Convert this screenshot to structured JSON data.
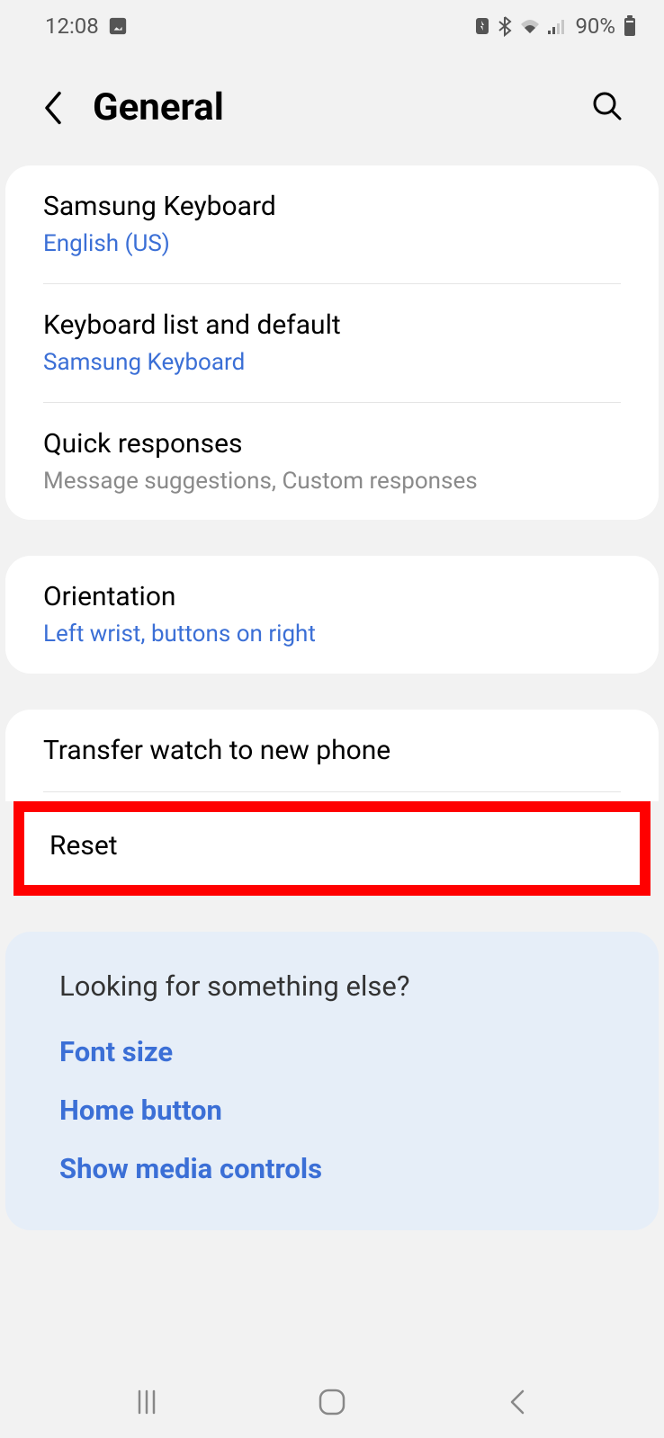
{
  "statusBar": {
    "time": "12:08",
    "battery": "90%"
  },
  "header": {
    "title": "General"
  },
  "section1": {
    "items": [
      {
        "title": "Samsung Keyboard",
        "subtitle": "English (US)",
        "subtitleColor": "blue"
      },
      {
        "title": "Keyboard list and default",
        "subtitle": "Samsung Keyboard",
        "subtitleColor": "blue"
      },
      {
        "title": "Quick responses",
        "subtitle": "Message suggestions, Custom responses",
        "subtitleColor": "gray"
      }
    ]
  },
  "section2": {
    "items": [
      {
        "title": "Orientation",
        "subtitle": "Left wrist, buttons on right",
        "subtitleColor": "blue"
      }
    ]
  },
  "section3": {
    "items": [
      {
        "title": "Transfer watch to new phone"
      },
      {
        "title": "Reset"
      }
    ]
  },
  "suggestions": {
    "title": "Looking for something else?",
    "links": [
      "Font size",
      "Home button",
      "Show media controls"
    ]
  }
}
